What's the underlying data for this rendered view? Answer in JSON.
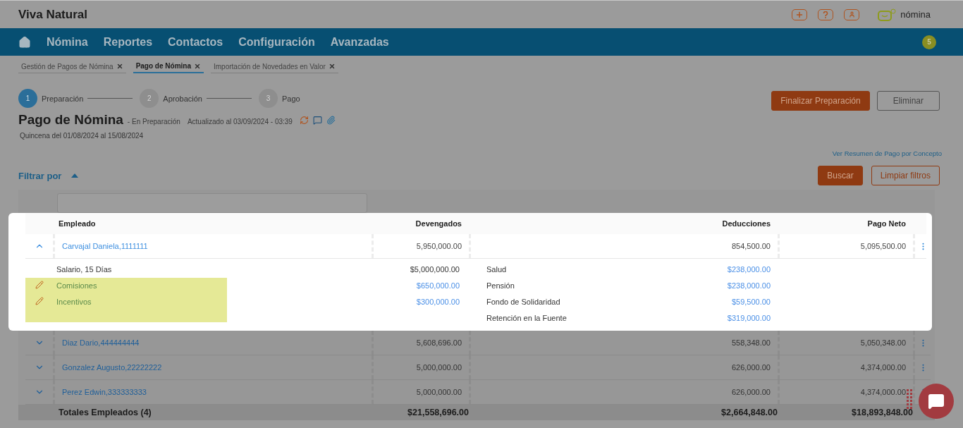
{
  "app": {
    "title": "Viva Natural",
    "brand": "nómina"
  },
  "nav": {
    "items": [
      "Nómina",
      "Reportes",
      "Contactos",
      "Configuración",
      "Avanzadas"
    ],
    "badge": "5"
  },
  "tabs": [
    {
      "label": "Gestión de Pagos de Nómina",
      "selected": false
    },
    {
      "label": "Pago de Nómina",
      "selected": true
    },
    {
      "label": "Importación de Novedades en Valor",
      "selected": false
    }
  ],
  "steps": [
    {
      "number": "1",
      "label": "Preparación",
      "active": true
    },
    {
      "number": "2",
      "label": "Aprobación",
      "active": false
    },
    {
      "number": "3",
      "label": "Pago",
      "active": false
    }
  ],
  "page": {
    "title": "Pago de Nómina",
    "status": "- En Preparación",
    "updated": "Actualizado al 03/09/2024 - 03:39",
    "period": "Quincena del 01/08/2024 al 15/08/2024"
  },
  "actions": [
    "Finalizar Preparación",
    "Eliminar"
  ],
  "summary_link": "Ver Resumen de Pago por Concepto",
  "filter": {
    "label": "Filtrar por",
    "expanded": true,
    "buttons": [
      "Buscar",
      "Limpiar filtros"
    ]
  },
  "table": {
    "columns": [
      "Empleado",
      "Devengados",
      "Deducciones",
      "Pago Neto"
    ],
    "rows": [
      {
        "employee": "Carvajal Daniela,1111111",
        "devengados": "5,950,000.00",
        "deducciones": "854,500.00",
        "pago_neto": "5,095,500.00",
        "expanded": true,
        "earnings": [
          {
            "concept": "Salario, 15 Días",
            "amount": "$5,000,000.00",
            "editable": false
          },
          {
            "concept": "Comisiones",
            "amount": "$650,000.00",
            "editable": true
          },
          {
            "concept": "Incentivos",
            "amount": "$300,000.00",
            "editable": true
          }
        ],
        "deductions": [
          {
            "concept": "Salud",
            "amount": "$238,000.00"
          },
          {
            "concept": "Pensión",
            "amount": "$238,000.00"
          },
          {
            "concept": "Fondo de Solidaridad",
            "amount": "$59,500.00"
          },
          {
            "concept": "Retención en la Fuente",
            "amount": "$319,000.00"
          }
        ]
      },
      {
        "employee": "Diaz Dario,444444444",
        "devengados": "5,608,696.00",
        "deducciones": "558,348.00",
        "pago_neto": "5,050,348.00",
        "expanded": false
      },
      {
        "employee": "Gonzalez Augusto,22222222",
        "devengados": "5,000,000.00",
        "deducciones": "626,000.00",
        "pago_neto": "4,374,000.00",
        "expanded": false
      },
      {
        "employee": "Perez Edwin,333333333",
        "devengados": "5,000,000.00",
        "deducciones": "626,000.00",
        "pago_neto": "4,374,000.00",
        "expanded": false
      }
    ],
    "totals": {
      "label": "Totales Empleados (4)",
      "devengados": "$21,558,696.00",
      "deducciones": "$2,664,848.00",
      "pago_neto": "$18,893,848.00"
    }
  }
}
